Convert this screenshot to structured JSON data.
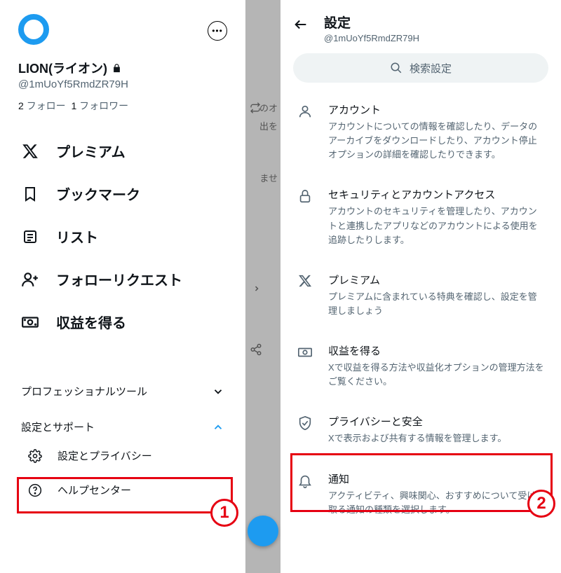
{
  "left": {
    "profile": {
      "display_name": "LION(ライオン)",
      "handle": "@1mUoYf5RmdZR79H",
      "followingCount": "2",
      "followingLabel": "フォロー",
      "followerCount": "1",
      "followerLabel": "フォロワー"
    },
    "menu": {
      "premium": "プレミアム",
      "bookmarks": "ブックマーク",
      "lists": "リスト",
      "followReq": "フォローリクエスト",
      "monetize": "収益を得る"
    },
    "sections": {
      "proTools": "プロフェッショナルツール",
      "support": "設定とサポート",
      "settings": "設定とプライバシー",
      "help": "ヘルプセンター"
    },
    "gapText1": "のオ",
    "gapText2": "出を",
    "gapText3": "ませ"
  },
  "right": {
    "title": "設定",
    "handle": "@1mUoYf5RmdZR79H",
    "searchPlaceholder": "検索設定",
    "items": {
      "account": {
        "title": "アカウント",
        "desc": "アカウントについての情報を確認したり、データのアーカイブをダウンロードしたり、アカウント停止オプションの詳細を確認したりできます。"
      },
      "security": {
        "title": "セキュリティとアカウントアクセス",
        "desc": "アカウントのセキュリティを管理したり、アカウントと連携したアプリなどのアカウントによる使用を追跡したりします。"
      },
      "premium": {
        "title": "プレミアム",
        "desc": "プレミアムに含まれている特典を確認し、設定を管理しましょう"
      },
      "monetize": {
        "title": "収益を得る",
        "desc": "Xで収益を得る方法や収益化オプションの管理方法をご覧ください。"
      },
      "privacy": {
        "title": "プライバシーと安全",
        "desc": "Xで表示および共有する情報を管理します。"
      },
      "notif": {
        "title": "通知",
        "desc": "アクティビティ、興味関心、おすすめについて受け取る通知の種類を選択します。"
      }
    }
  },
  "badges": {
    "one": "1",
    "two": "2"
  }
}
